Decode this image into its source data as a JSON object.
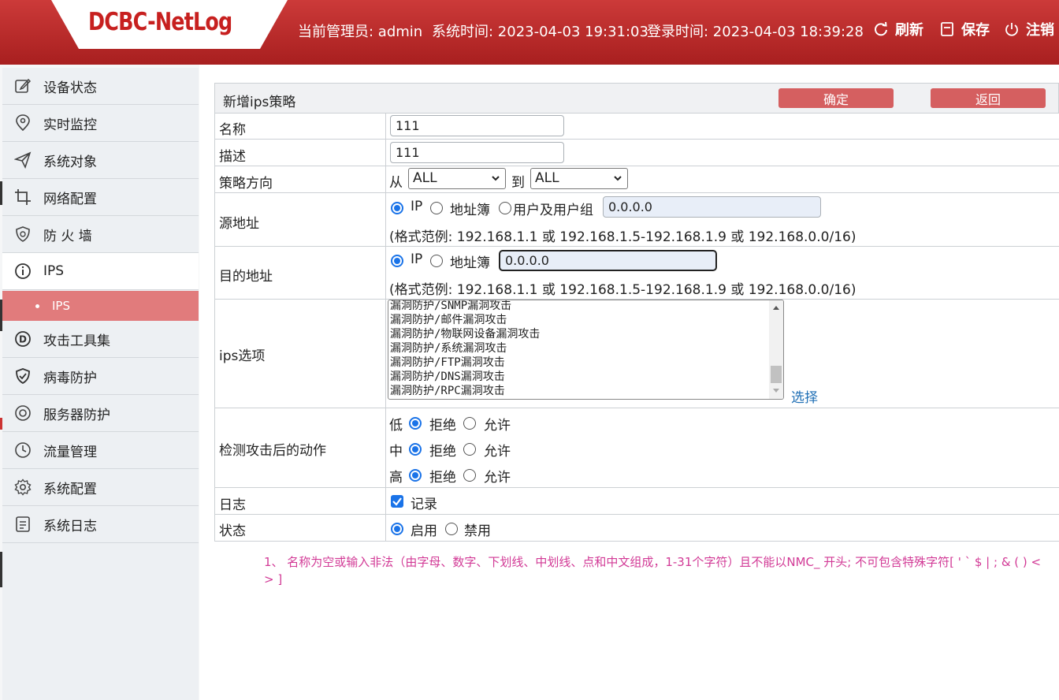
{
  "header": {
    "logo": "DCBC-NetLog",
    "admin_label": "当前管理员: admin",
    "sys_time": "系统时间: 2023-04-03 19:31:03",
    "login_time": "登录时间: 2023-04-03 18:39:28",
    "refresh": "刷新",
    "save": "保存",
    "logout": "注销"
  },
  "sidebar": {
    "items": [
      {
        "label": "设备状态",
        "icon": "edit-icon"
      },
      {
        "label": "实时监控",
        "icon": "location-icon"
      },
      {
        "label": "系统对象",
        "icon": "send-icon"
      },
      {
        "label": "网络配置",
        "icon": "crop-icon"
      },
      {
        "label": "防 火 墙",
        "icon": "shield-icon"
      },
      {
        "label": "IPS",
        "icon": "info-icon"
      },
      {
        "label": "攻击工具集",
        "icon": "d-circle-icon"
      },
      {
        "label": "病毒防护",
        "icon": "shield-check-icon"
      },
      {
        "label": "服务器防护",
        "icon": "target-icon"
      },
      {
        "label": "流量管理",
        "icon": "clock-icon"
      },
      {
        "label": "系统配置",
        "icon": "gear-icon"
      },
      {
        "label": "系统日志",
        "icon": "log-icon"
      }
    ],
    "sub_item": "IPS"
  },
  "panel": {
    "title": "新增ips策略",
    "ok": "确定",
    "back": "返回"
  },
  "form": {
    "name_label": "名称",
    "name_value": "111",
    "desc_label": "描述",
    "desc_value": "111",
    "dir_label": "策略方向",
    "from": "从",
    "to": "到",
    "from_value": "ALL",
    "to_value": "ALL",
    "src_label": "源地址",
    "opt_ip": "IP",
    "opt_book": "地址簿",
    "opt_user": "用户及用户组",
    "src_value": "0.0.0.0",
    "format_hint": "(格式范例: 192.168.1.1 或 192.168.1.5-192.168.1.9 或 192.168.0.0/16)",
    "dst_label": "目的地址",
    "dst_value": "0.0.0.0",
    "ips_label": "ips选项",
    "ips_options": [
      "漏洞防护/SNMP漏洞攻击",
      "漏洞防护/邮件漏洞攻击",
      "漏洞防护/物联网设备漏洞攻击",
      "漏洞防护/系统漏洞攻击",
      "漏洞防护/FTP漏洞攻击",
      "漏洞防护/DNS漏洞攻击",
      "漏洞防护/RPC漏洞攻击"
    ],
    "select_link": "选择",
    "action_label": "检测攻击后的动作",
    "low": "低",
    "mid": "中",
    "high": "高",
    "deny": "拒绝",
    "allow": "允许",
    "log_label": "日志",
    "log_check": "记录",
    "status_label": "状态",
    "enable": "启用",
    "disable": "禁用"
  },
  "note": "1、 名称为空或输入非法（由字母、数字、下划线、中划线、点和中文组成，1-31个字符）且不能以NMC_ 开头; 不可包含特殊字符[ ' ` $ | ; & ( ) < > ]",
  "colors": {
    "header": "#b82a2a",
    "accent": "#d55f60",
    "link": "#1f6fb5",
    "note": "#d23a96"
  }
}
